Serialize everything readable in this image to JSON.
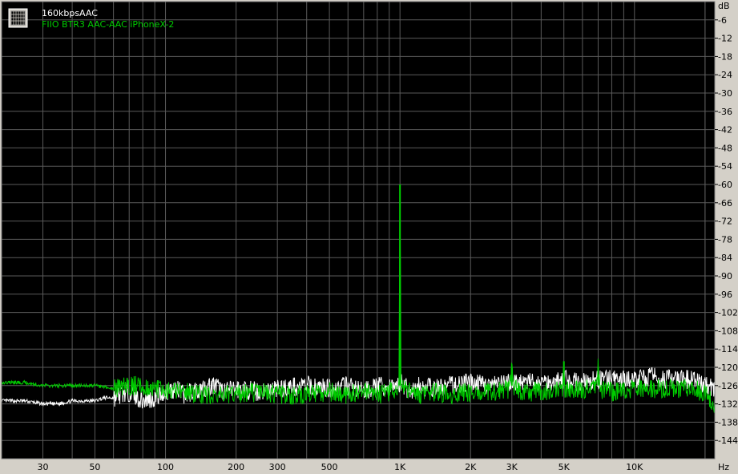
{
  "chart_data": {
    "type": "line",
    "title": "",
    "xlabel": "Hz",
    "ylabel": "dB",
    "xscale": "log",
    "xlim": [
      20,
      22000
    ],
    "ylim": [
      -150,
      0
    ],
    "grid": true,
    "legend_position": "top-left",
    "background_color": "#000000",
    "grid_color": "#5a5a5a",
    "x_ticks": [
      {
        "value": 30,
        "label": "30"
      },
      {
        "value": 50,
        "label": "50"
      },
      {
        "value": 100,
        "label": "100"
      },
      {
        "value": 200,
        "label": "200"
      },
      {
        "value": 300,
        "label": "300"
      },
      {
        "value": 500,
        "label": "500"
      },
      {
        "value": 1000,
        "label": "1K"
      },
      {
        "value": 2000,
        "label": "2K"
      },
      {
        "value": 3000,
        "label": "3K"
      },
      {
        "value": 5000,
        "label": "5K"
      },
      {
        "value": 10000,
        "label": "10K"
      }
    ],
    "y_ticks": [
      {
        "value": -6,
        "label": "-6"
      },
      {
        "value": -12,
        "label": "-12"
      },
      {
        "value": -18,
        "label": "-18"
      },
      {
        "value": -24,
        "label": "-24"
      },
      {
        "value": -30,
        "label": "-30"
      },
      {
        "value": -36,
        "label": "-36"
      },
      {
        "value": -42,
        "label": "-42"
      },
      {
        "value": -48,
        "label": "-48"
      },
      {
        "value": -54,
        "label": "-54"
      },
      {
        "value": -60,
        "label": "-60"
      },
      {
        "value": -66,
        "label": "-66"
      },
      {
        "value": -72,
        "label": "-72"
      },
      {
        "value": -78,
        "label": "-78"
      },
      {
        "value": -84,
        "label": "-84"
      },
      {
        "value": -90,
        "label": "-90"
      },
      {
        "value": -96,
        "label": "-96"
      },
      {
        "value": -102,
        "label": "-102"
      },
      {
        "value": -108,
        "label": "-108"
      },
      {
        "value": -114,
        "label": "-114"
      },
      {
        "value": -120,
        "label": "-120"
      },
      {
        "value": -126,
        "label": "-126"
      },
      {
        "value": -132,
        "label": "-132"
      },
      {
        "value": -138,
        "label": "-138"
      },
      {
        "value": -144,
        "label": "-144"
      }
    ],
    "series": [
      {
        "name": "160kbpsAAC",
        "color": "#ffffff",
        "x": [
          20,
          25,
          30,
          35,
          40,
          45,
          50,
          55,
          60,
          65,
          70,
          80,
          90,
          100,
          110,
          120,
          140,
          160,
          180,
          200,
          250,
          300,
          400,
          500,
          600,
          700,
          800,
          900,
          950,
          990,
          1000,
          1010,
          1050,
          1100,
          1200,
          1400,
          1600,
          2000,
          2500,
          3000,
          4000,
          5000,
          6000,
          7000,
          8000,
          10000,
          12000,
          14000,
          16000,
          18000,
          20000,
          22000
        ],
        "y": [
          -131,
          -131,
          -132,
          -132,
          -131,
          -131,
          -131,
          -130,
          -130,
          -129,
          -128,
          -131,
          -130,
          -128,
          -127,
          -129,
          -127,
          -126,
          -128,
          -127,
          -128,
          -127,
          -126,
          -127,
          -126,
          -128,
          -126,
          -127,
          -126,
          -125,
          -126,
          -125,
          -126,
          -128,
          -126,
          -127,
          -126,
          -125,
          -126,
          -125,
          -125,
          -124,
          -125,
          -124,
          -124,
          -124,
          -123,
          -124,
          -124,
          -124,
          -126,
          -127
        ]
      },
      {
        "name": "FIIO BTR3 AAC-AAC iPhoneX-2",
        "color": "#00cc00",
        "x": [
          20,
          25,
          30,
          40,
          50,
          60,
          70,
          80,
          90,
          100,
          120,
          150,
          200,
          250,
          300,
          400,
          500,
          600,
          700,
          800,
          900,
          950,
          990,
          1000,
          1010,
          1050,
          1100,
          1200,
          1400,
          1600,
          2000,
          2500,
          2950,
          3000,
          3050,
          3500,
          4000,
          4950,
          5000,
          5050,
          6000,
          6900,
          7000,
          7100,
          8000,
          10000,
          12000,
          14000,
          16000,
          18000,
          20000,
          22000
        ],
        "y": [
          -125,
          -125,
          -126,
          -126,
          -126,
          -127,
          -126,
          -126,
          -127,
          -128,
          -128,
          -129,
          -129,
          -128,
          -129,
          -129,
          -128,
          -129,
          -128,
          -129,
          -128,
          -127,
          -126,
          -60,
          -126,
          -127,
          -128,
          -129,
          -128,
          -129,
          -128,
          -128,
          -127,
          -120,
          -127,
          -128,
          -128,
          -127,
          -118,
          -127,
          -127,
          -127,
          -120,
          -127,
          -128,
          -127,
          -127,
          -127,
          -127,
          -127,
          -129,
          -132
        ]
      }
    ]
  }
}
